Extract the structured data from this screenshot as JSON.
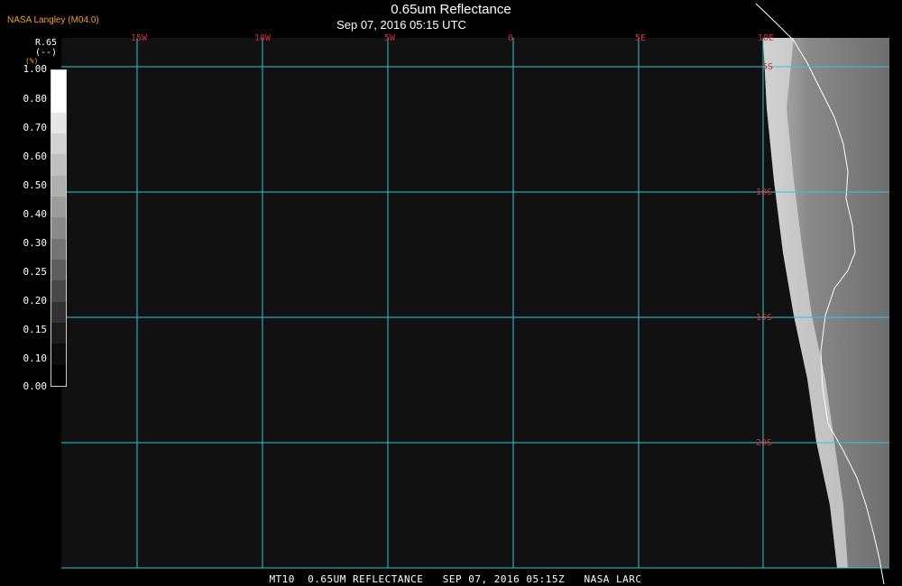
{
  "header": {
    "credit": "NASA Langley (M04.0)",
    "title": "0.65um Reflectance",
    "subtitle": "Sep 07, 2016 05:15 UTC"
  },
  "legend": {
    "label_line1": "R.65",
    "label_line2": "(--)",
    "unit_mark": "(%)",
    "ticks": [
      "1.00",
      "0.80",
      "0.70",
      "0.60",
      "0.50",
      "0.40",
      "0.30",
      "0.25",
      "0.20",
      "0.15",
      "0.10",
      "0.00"
    ],
    "swatch_colors": [
      "#ffffff",
      "#ffffff",
      "#e6e6e6",
      "#d2d2d2",
      "#c0c0c0",
      "#aeaeae",
      "#9c9c9c",
      "#8a8a8a",
      "#747474",
      "#5e5e5e",
      "#484848",
      "#323232",
      "#1c1c1c",
      "#0c0c0c",
      "#000000"
    ]
  },
  "map": {
    "longitude_labels": [
      "15W",
      "10W",
      "5W",
      "0",
      "5E",
      "10E"
    ],
    "latitude_labels": [
      "5S",
      "10S",
      "15S",
      "20S"
    ],
    "grid_color": "#30c8d8",
    "label_color": "#d43030",
    "ocean_color": "#111111"
  },
  "footer": {
    "text": "MT10  0.65UM REFLECTANCE   SEP 07, 2016 05:15Z   NASA LARC"
  }
}
